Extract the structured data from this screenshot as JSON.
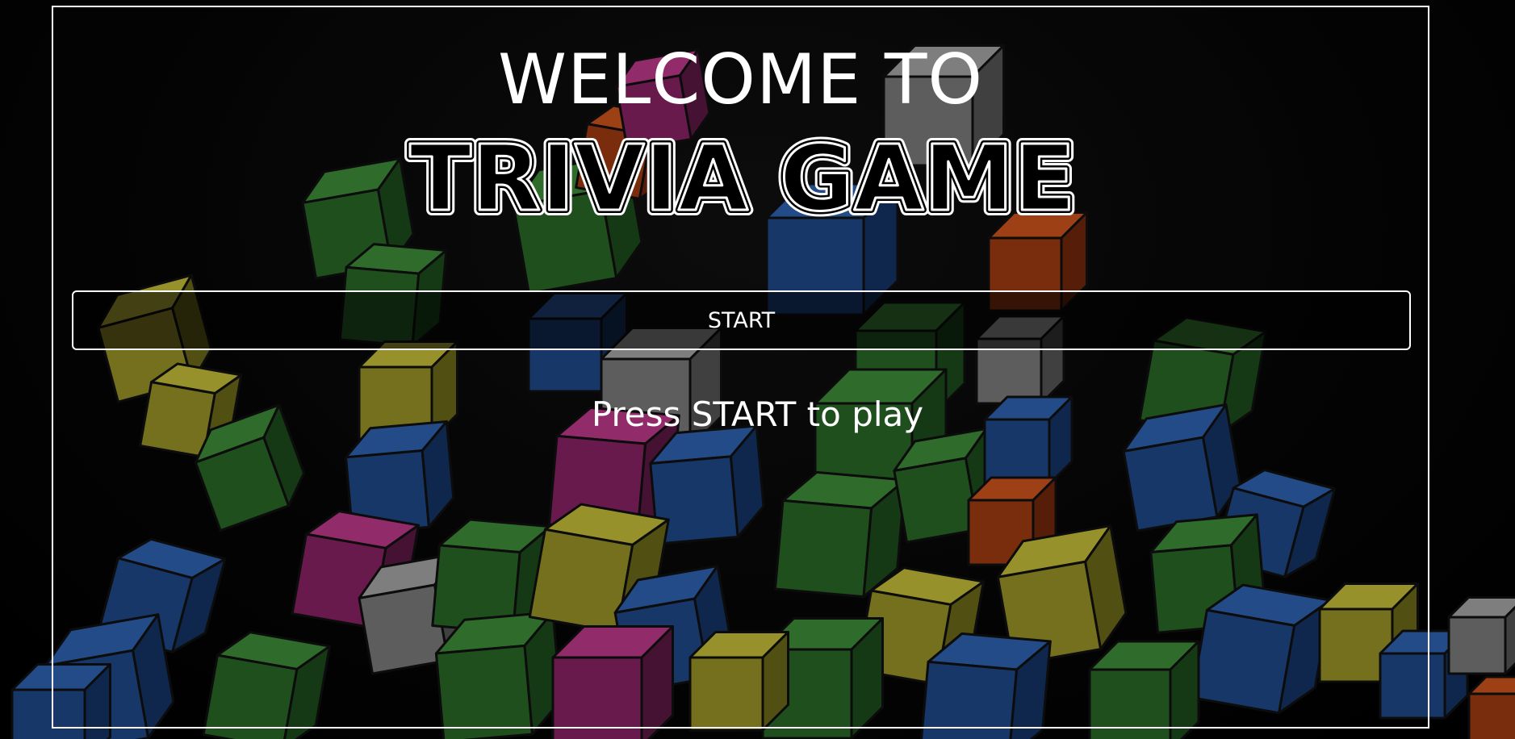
{
  "welcome_text": "WELCOME TO",
  "game_title": "TRIVIA GAME",
  "start_button_label": "START",
  "instruction_text": "Press START to play",
  "background_image": "colorful-3d-cubes",
  "colors": {
    "text": "#ffffff",
    "border": "#ffffff",
    "background": "#000000"
  }
}
